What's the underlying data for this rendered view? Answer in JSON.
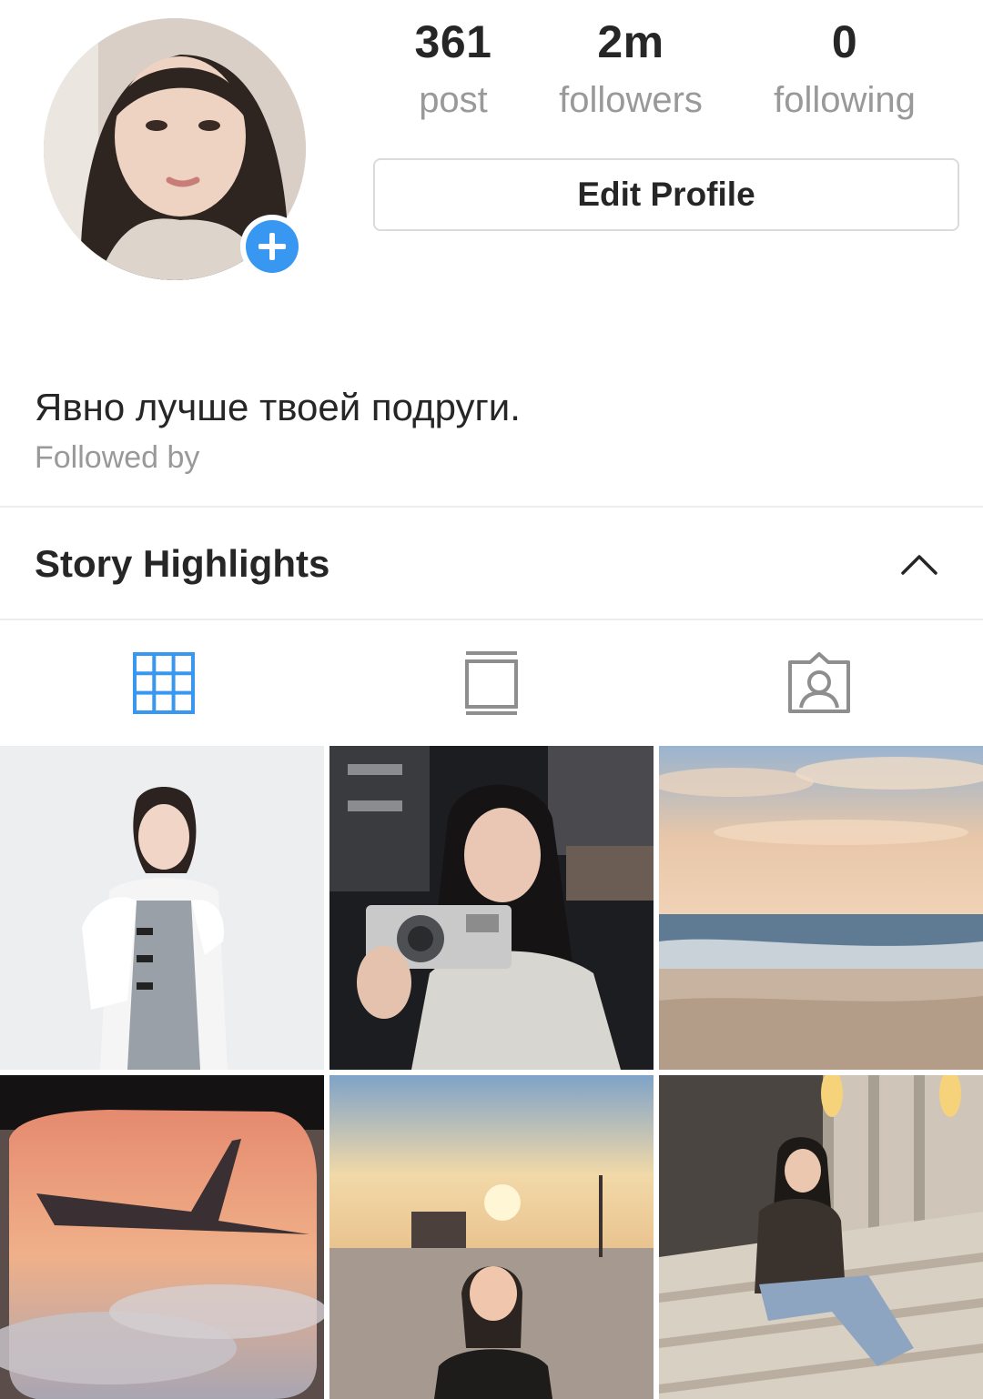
{
  "profile": {
    "stats": [
      {
        "value": "361",
        "label": "post"
      },
      {
        "value": "2m",
        "label": "followers"
      },
      {
        "value": "0",
        "label": "following"
      }
    ],
    "edit_button_label": "Edit Profile",
    "bio": "Явно лучше твоей подруги.",
    "followed_by": "Followed by"
  },
  "highlights": {
    "title": "Story Highlights",
    "expanded": true
  },
  "tabs": [
    {
      "icon": "grid-icon",
      "active": true
    },
    {
      "icon": "feed-icon",
      "active": false
    },
    {
      "icon": "tagged-icon",
      "active": false
    }
  ],
  "colors": {
    "accent": "#3897f0",
    "muted": "#999999",
    "text": "#262626",
    "border": "#dbdbdb"
  },
  "photos": [
    {
      "icon": "portrait-photo"
    },
    {
      "icon": "camera-photo"
    },
    {
      "icon": "beach-sunset-photo"
    },
    {
      "icon": "airplane-window-photo"
    },
    {
      "icon": "beach-selfie-photo"
    },
    {
      "icon": "stairs-photo"
    }
  ]
}
